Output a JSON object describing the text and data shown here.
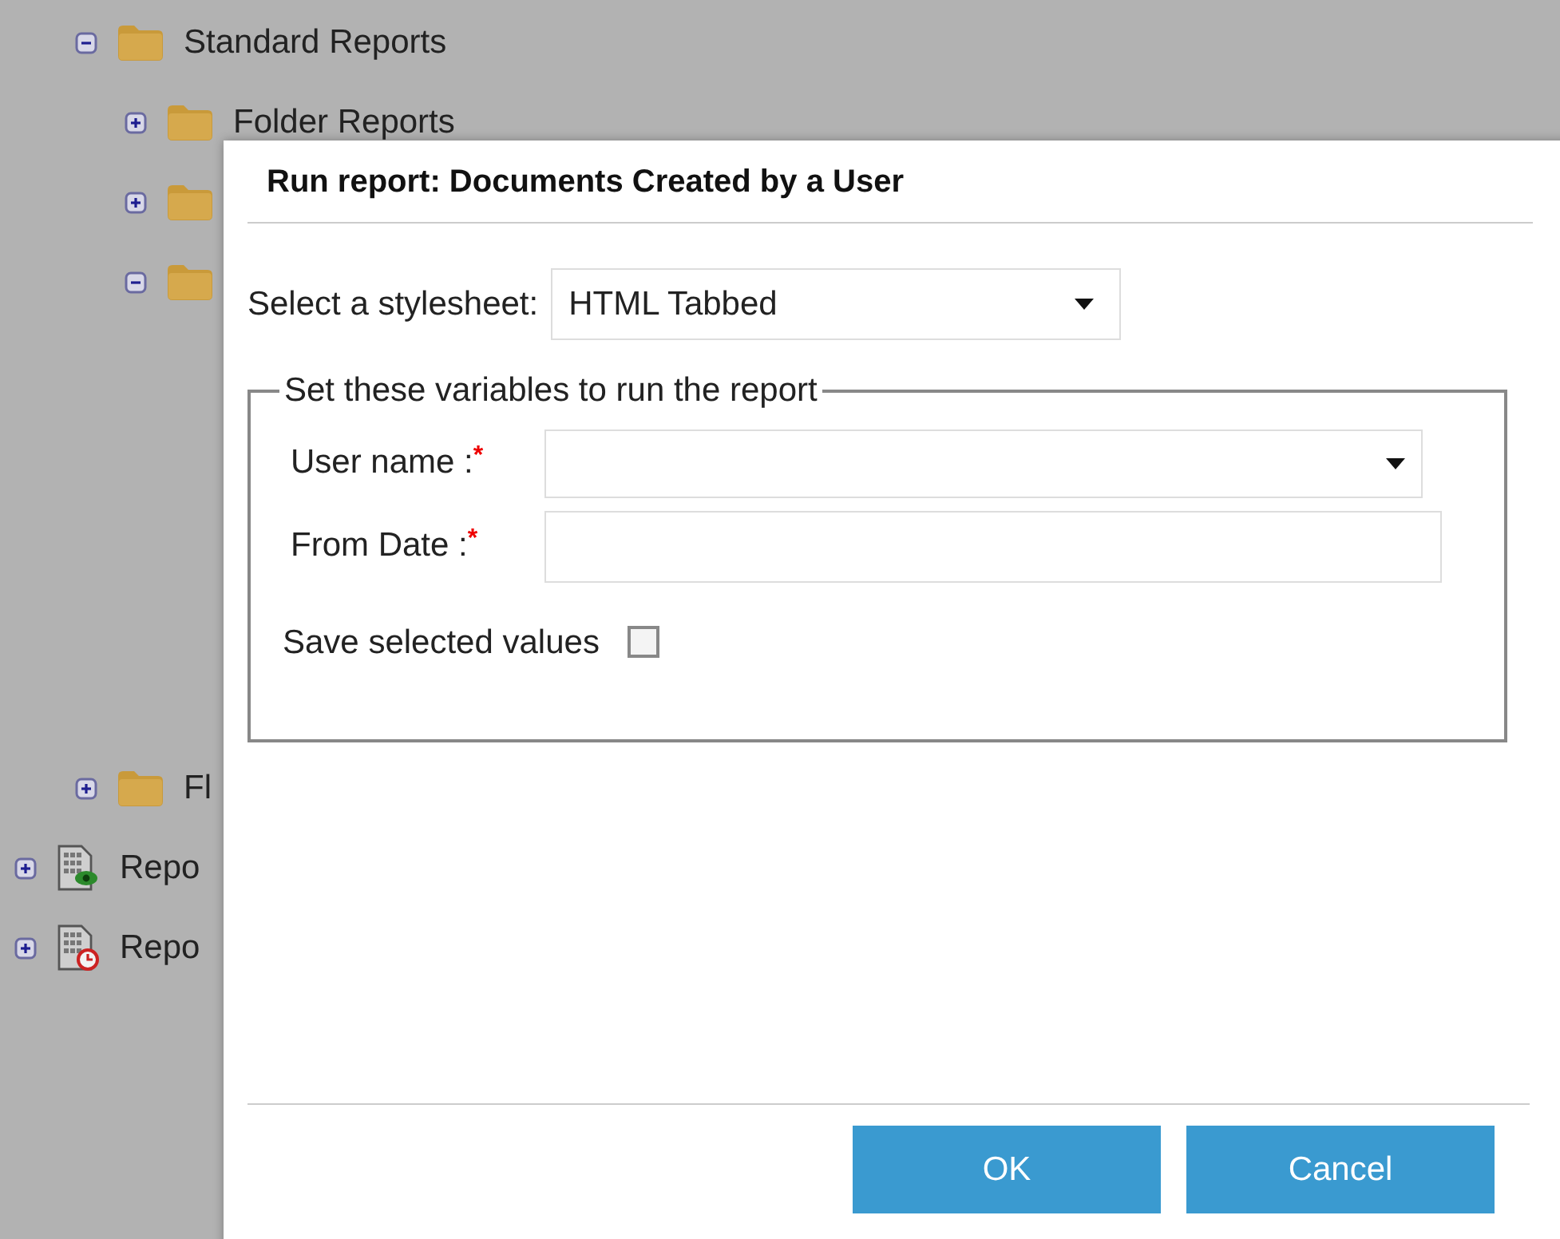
{
  "tree": {
    "folders": [
      {
        "label": "Standard Reports",
        "expanded": true,
        "children": [
          {
            "label": "Folder Reports",
            "expanded": false
          },
          {
            "expanded": false
          },
          {
            "expanded": true
          }
        ]
      },
      {
        "label": "Fl",
        "expanded": false
      }
    ],
    "reports": [
      {
        "label": "Repo",
        "expanded": false,
        "kind": "view"
      },
      {
        "label": "Repo",
        "expanded": false,
        "kind": "scheduled"
      }
    ]
  },
  "dialog": {
    "title": "Run report: Documents Created by a User",
    "stylesheet_label": "Select a stylesheet:",
    "stylesheet_value": "HTML Tabbed",
    "fieldset_legend": "Set these variables to run the report",
    "fields": [
      {
        "label": "User name :",
        "required_mark": "*",
        "kind": "select"
      },
      {
        "label": "From Date :",
        "required_mark": "*",
        "kind": "text"
      }
    ],
    "save_label": "Save selected values",
    "save_checked": false,
    "buttons": [
      "OK",
      "Cancel"
    ]
  }
}
